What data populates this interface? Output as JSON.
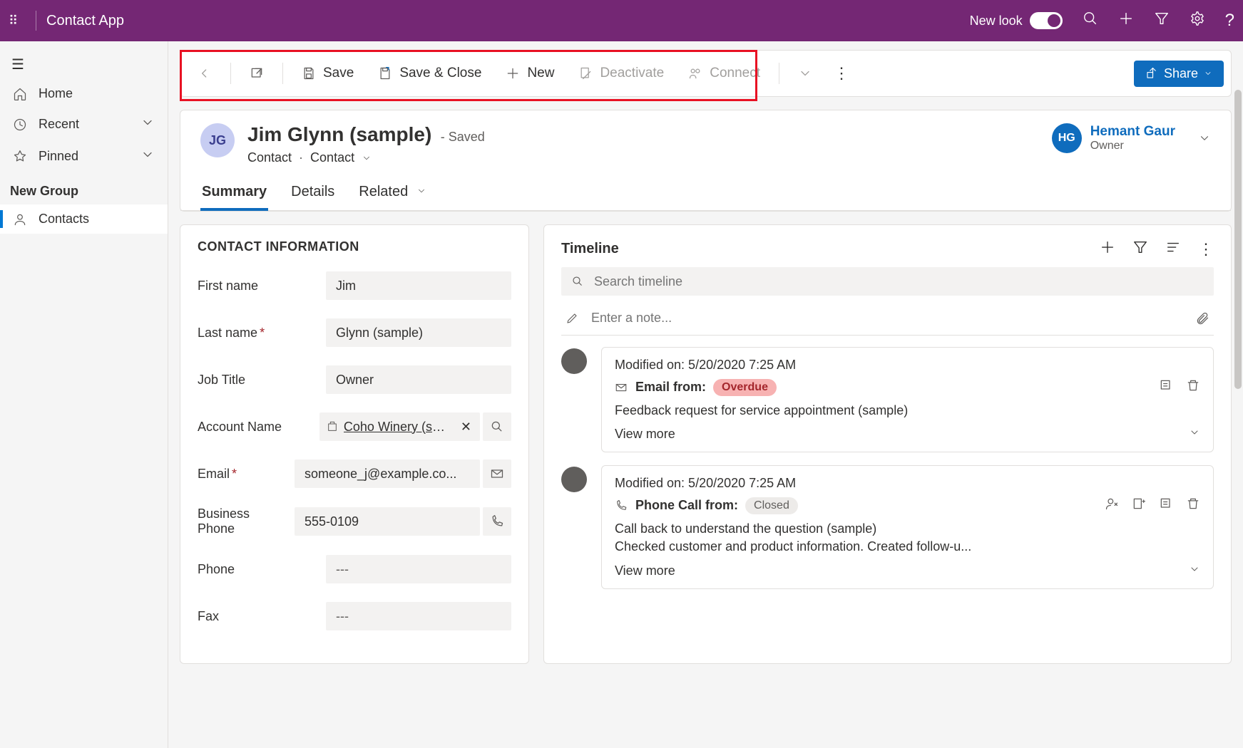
{
  "topbar": {
    "app_title": "Contact App",
    "new_look_label": "New look"
  },
  "sidebar": {
    "home": "Home",
    "recent": "Recent",
    "pinned": "Pinned",
    "group_header": "New Group",
    "contacts": "Contacts"
  },
  "commands": {
    "save": "Save",
    "save_close": "Save & Close",
    "new": "New",
    "deactivate": "Deactivate",
    "connect": "Connect",
    "share": "Share"
  },
  "record": {
    "avatar_initials": "JG",
    "title": "Jim Glynn (sample)",
    "status": "- Saved",
    "entity": "Contact",
    "form": "Contact",
    "owner": {
      "initials": "HG",
      "name": "Hemant Gaur",
      "role": "Owner"
    },
    "tabs": {
      "summary": "Summary",
      "details": "Details",
      "related": "Related"
    }
  },
  "form": {
    "section_title": "CONTACT INFORMATION",
    "first_name": {
      "label": "First name",
      "value": "Jim"
    },
    "last_name": {
      "label": "Last name",
      "value": "Glynn (sample)"
    },
    "job_title": {
      "label": "Job Title",
      "value": "Owner"
    },
    "account": {
      "label": "Account Name",
      "value": "Coho Winery (sam..."
    },
    "email": {
      "label": "Email",
      "value": "someone_j@example.co..."
    },
    "business_phone": {
      "label": "Business Phone",
      "value": "555-0109"
    },
    "phone": {
      "label": "Phone",
      "value": "---"
    },
    "fax": {
      "label": "Fax",
      "value": "---"
    }
  },
  "timeline": {
    "title": "Timeline",
    "search_placeholder": "Search timeline",
    "note_placeholder": "Enter a note...",
    "items": [
      {
        "modified": "Modified on: 5/20/2020 7:25 AM",
        "type_label": "Email from:",
        "badge": "Overdue",
        "badge_kind": "overdue",
        "body": "Feedback request for service appointment (sample)",
        "view_more": "View more"
      },
      {
        "modified": "Modified on: 5/20/2020 7:25 AM",
        "type_label": "Phone Call from:",
        "badge": "Closed",
        "badge_kind": "closed",
        "body": "Call back to understand the question (sample)\nChecked customer and product information. Created follow-u...",
        "view_more": "View more"
      }
    ]
  }
}
